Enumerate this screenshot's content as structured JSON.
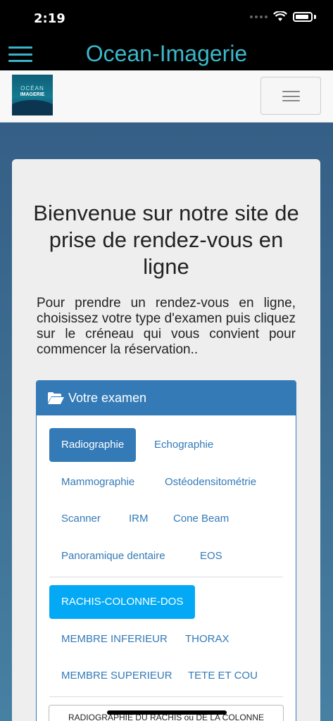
{
  "status": {
    "time": "2:19"
  },
  "app": {
    "title": "Ocean-Imagerie"
  },
  "logo": {
    "line1": "OCÉAN",
    "line2": "IMAGERIE"
  },
  "welcome": {
    "title": "Bienvenue sur notre site de prise de rendez-vous en ligne",
    "intro": "Pour prendre un rendez-vous en ligne, choisissez votre type d'examen puis cliquez sur le créneau qui vous convient pour commencer la réservation.."
  },
  "panel": {
    "heading": "Votre examen"
  },
  "exam_types": [
    "Radiographie",
    "Echographie",
    "Mammographie",
    "Ostéodensitométrie",
    "Scanner",
    "IRM",
    "Cone Beam",
    "Panoramique dentaire",
    "EOS"
  ],
  "exam_selected": "Radiographie",
  "regions": [
    "RACHIS-COLONNE-DOS",
    "MEMBRE INFERIEUR",
    "THORAX",
    "MEMBRE SUPERIEUR",
    "TETE ET COU"
  ],
  "region_selected": "RACHIS-COLONNE-DOS",
  "sub_exam": {
    "label": "RADIOGRAPHIE DU RACHIS ou DE LA COLONNE"
  },
  "colors": {
    "primary": "#337ab7",
    "accent": "#03a9f4",
    "app_title": "#3bb8c9"
  }
}
